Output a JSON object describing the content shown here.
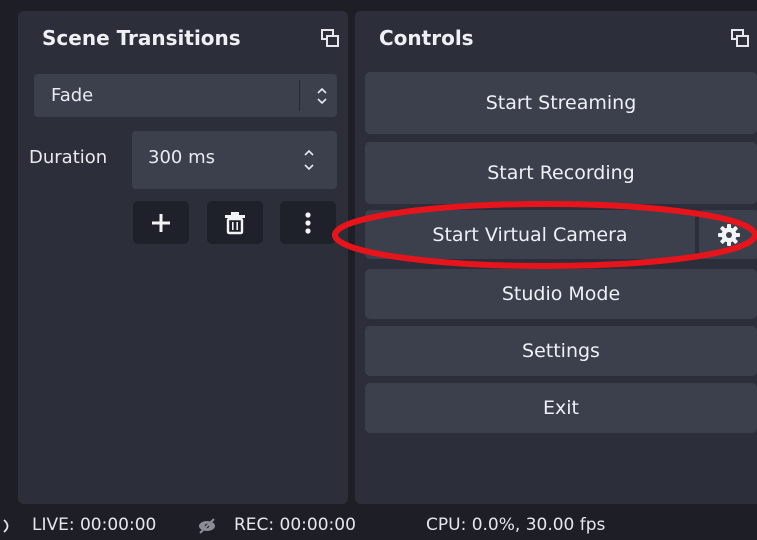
{
  "scene_transitions": {
    "title": "Scene Transitions",
    "transition_value": "Fade",
    "duration_label": "Duration",
    "duration_value": "300 ms"
  },
  "controls": {
    "title": "Controls",
    "buttons": {
      "start_streaming": "Start Streaming",
      "start_recording": "Start Recording",
      "start_virtual_camera": "Start Virtual Camera",
      "studio_mode": "Studio Mode",
      "settings": "Settings",
      "exit": "Exit"
    }
  },
  "status_bar": {
    "live": "LIVE: 00:00:00",
    "rec": "REC: 00:00:00",
    "cpu": "CPU: 0.0%, 30.00 fps"
  },
  "colors": {
    "background": "#1d1e26",
    "dock": "#2c2e39",
    "button": "#3c404d",
    "annotation_ellipse": "#e8141b"
  },
  "icons": [
    "float-dock-icon",
    "chevron-up-down-icon",
    "plus-icon",
    "trash-icon",
    "kebab-menu-icon",
    "gear-icon",
    "broadcast-icon",
    "eye-slash-icon"
  ]
}
